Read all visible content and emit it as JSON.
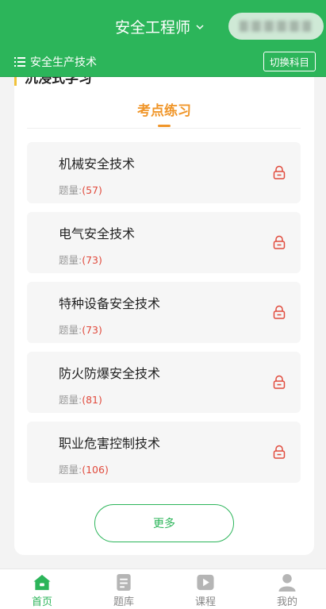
{
  "header": {
    "title": "安全工程师",
    "subject": "安全生产技术",
    "switch_label": "切换科目"
  },
  "card": {
    "cut_title": "沉浸式学习",
    "section_title": "考点练习",
    "items": [
      {
        "title": "机械安全技术",
        "count_label": "题量:",
        "count": "(57)"
      },
      {
        "title": "电气安全技术",
        "count_label": "题量:",
        "count": "(73)"
      },
      {
        "title": "特种设备安全技术",
        "count_label": "题量:",
        "count": "(73)"
      },
      {
        "title": "防火防爆安全技术",
        "count_label": "题量:",
        "count": "(81)"
      },
      {
        "title": "职业危害控制技术",
        "count_label": "题量:",
        "count": "(106)"
      }
    ],
    "more_label": "更多"
  },
  "tabbar": {
    "tabs": [
      {
        "label": "首页",
        "icon": "home-icon",
        "active": true
      },
      {
        "label": "题库",
        "icon": "document-icon",
        "active": false
      },
      {
        "label": "课程",
        "icon": "play-icon",
        "active": false
      },
      {
        "label": "我的",
        "icon": "user-icon",
        "active": false
      }
    ]
  },
  "colors": {
    "brand_green": "#2cb55a",
    "accent_orange": "#f0962a",
    "count_red": "#e14a3c"
  }
}
